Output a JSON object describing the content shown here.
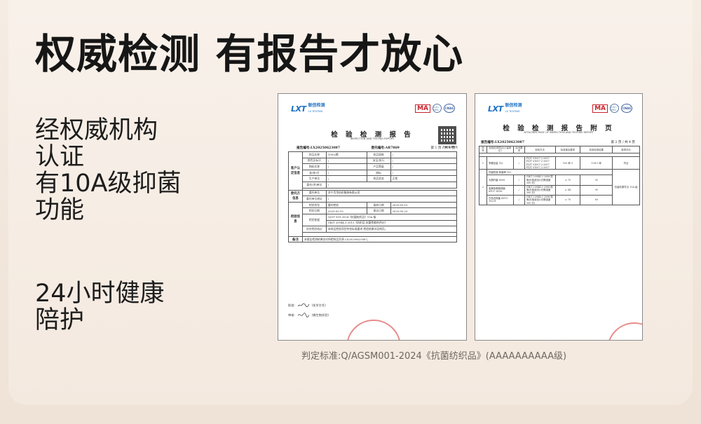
{
  "headline": "权威检测 有报告才放心",
  "features": [
    {
      "lines": [
        "经权威机构",
        "认证",
        "有10A级抑菌",
        "功能"
      ]
    },
    {
      "lines": [
        "24小时健康",
        "陪护"
      ]
    }
  ],
  "footnote": "判定标准:Q/AGSM001-2024《抗菌纺织品》(AAAAAAAAAA级)",
  "lab": {
    "brand_cn": "联信检测",
    "brand_en": "LX TESTING",
    "certs": [
      "MA",
      "ILAC-MRA",
      "CNAS"
    ]
  },
  "report1": {
    "title": "检 验 检 测 报 告",
    "subtitle": "INSPECTION AND TESTING REPORT",
    "report_no_label": "报告编号:",
    "report_no": "LX20250623087",
    "client_no_label": "委托编号:",
    "client_no": "AR7869",
    "page": "第 1 页 / 共 4 页",
    "qr_caption": "扫码查询报告",
    "groups": {
      "client": "客户认定信息",
      "entrust": "委托方信息",
      "test": "检验信息",
      "remark": "备注"
    },
    "rows": {
      "sample_name_label": "样品名称",
      "sample_name": "100%棉",
      "sample_spec_label": "样品规格",
      "sample_spec": "/",
      "color_label": "颜色及标识",
      "color": "/",
      "grade_label": "安全/执行",
      "grade": "/",
      "material_label": "物料名称",
      "material": "/",
      "prod_batch_label": "产品等级",
      "prod_batch": "/",
      "lot_label": "批(款)号",
      "lot": "/",
      "brand_label": "商标",
      "brand": "/",
      "maker_label": "生产单位",
      "maker": "/",
      "state_label": "样品状态",
      "state": "正常",
      "supplier_label": "委托(供)单位",
      "supplier": "/",
      "entrust_unit_label": "委托单位",
      "entrust_unit": "济宁百华纺织服装有限公司",
      "entrust_addr_label": "委托单位地址",
      "entrust_addr": "/",
      "test_type_label": "检验类型",
      "test_type": "委托检验",
      "receive_date_label": "接样日期",
      "receive_date": "2025-05-15",
      "test_date_label": "检验日期",
      "test_date": "2025-05-15",
      "report_date_label": "报告日期",
      "report_date": "2025-05-23",
      "basis_label": "检验依据",
      "basis_1": "Q/GT 003-2024《抗菌纺织品》10A 级",
      "basis_2": "GB/T 20944.3-2013《纺织品 抗菌性能的评价》",
      "conclusion_label": "综合检验结论",
      "conclusion": "本样品检验项目符合标准要求,检验结果详见附页。",
      "remark_text": "本报告检测结果仅对所检样品负责 LX20250623087。"
    },
    "approver_label": "批准:",
    "approver_note": "(化学主任)",
    "reviewer_label": "审核:",
    "reviewer_note": "(微生物实验)"
  },
  "report2": {
    "title": "检 验 检 测 报 告 附 页",
    "subtitle": "ATTACHED PAGE OF INSPECTION AND TESTING REPORT",
    "report_no_label": "报告编号:",
    "report_no": "LX20250623087",
    "page": "第 2 页 / 共 4 页",
    "headers": [
      "序号",
      "检验检测项目(计量单位)",
      "技术要求",
      "检验方法",
      "标准值及要求",
      "检验检测结果",
      "单项评价"
    ],
    "row1": {
      "no": "1",
      "item": "甲醛含量 (%)",
      "tech": "/",
      "method": "FZ/T 01007.2-2007 FZ/T 01007.2-2007 FZ/T 01007.2-2007 FZ/T 01007.2-2007",
      "standard": "100 种 0",
      "result": "104 0 种",
      "verdict": "符合"
    },
    "section_label": "抗菌性能-抑菌率 (%)",
    "row2": {
      "no": "2",
      "items": [
        {
          "name": "大肠杆菌 8099",
          "tech": "/",
          "method": "GB/T 20944.3-2008 振荡法(吸液法)(光照强度 300 次)",
          "standard": "≥ 75",
          "result": "95"
        },
        {
          "name": "金黄色葡萄球菌 ATCC 6538",
          "tech": "/",
          "method": "GB/T 20944.3-2008 振荡法(吸液法)(光照强度 300 次)",
          "standard": "≥ 84",
          "result": "95"
        },
        {
          "name": "白色念珠菌 ATCC 10231",
          "tech": "/",
          "method": "GB/T 20944.3-2008 振荡法(吸液法)(光照强度 300 次)",
          "standard": "≥ 70",
          "result": "89"
        }
      ],
      "verdict": "抗菌效果符合 10A 级"
    }
  },
  "colors": {
    "headline": "#161616",
    "accent_blue": "#1c6fc4",
    "stamp_red": "#d42d2d",
    "page_bg": "#f4e9df"
  }
}
